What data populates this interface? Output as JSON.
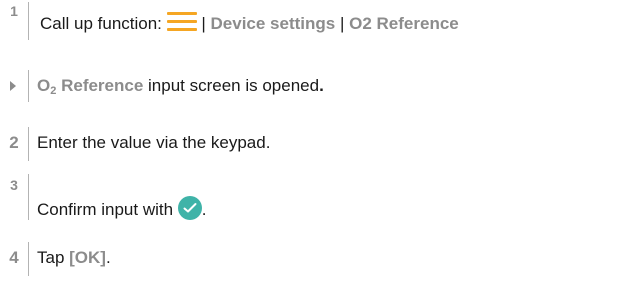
{
  "steps": [
    {
      "number": "1",
      "prefix": "Call up function: ",
      "sep1": " | ",
      "menu_path_1": "Device settings",
      "sep2": " | ",
      "menu_path_2": "O2 Reference",
      "icon": "menu-icon"
    },
    {
      "marker": "result",
      "highlight_main": "O",
      "highlight_sub": "2",
      "highlight_rest": " Reference",
      "text": " input screen is opened",
      "end": "."
    },
    {
      "number": "2",
      "text": "Enter the value via the keypad."
    },
    {
      "number": "3",
      "text": "Confirm input with ",
      "icon": "check-icon",
      "end": "."
    },
    {
      "number": "4",
      "text": "Tap ",
      "button_label": "[OK]",
      "end": "."
    }
  ],
  "colors": {
    "highlight": "#8c8c8c",
    "menu_icon": "#f5a623",
    "check_icon": "#3fb3a8"
  }
}
